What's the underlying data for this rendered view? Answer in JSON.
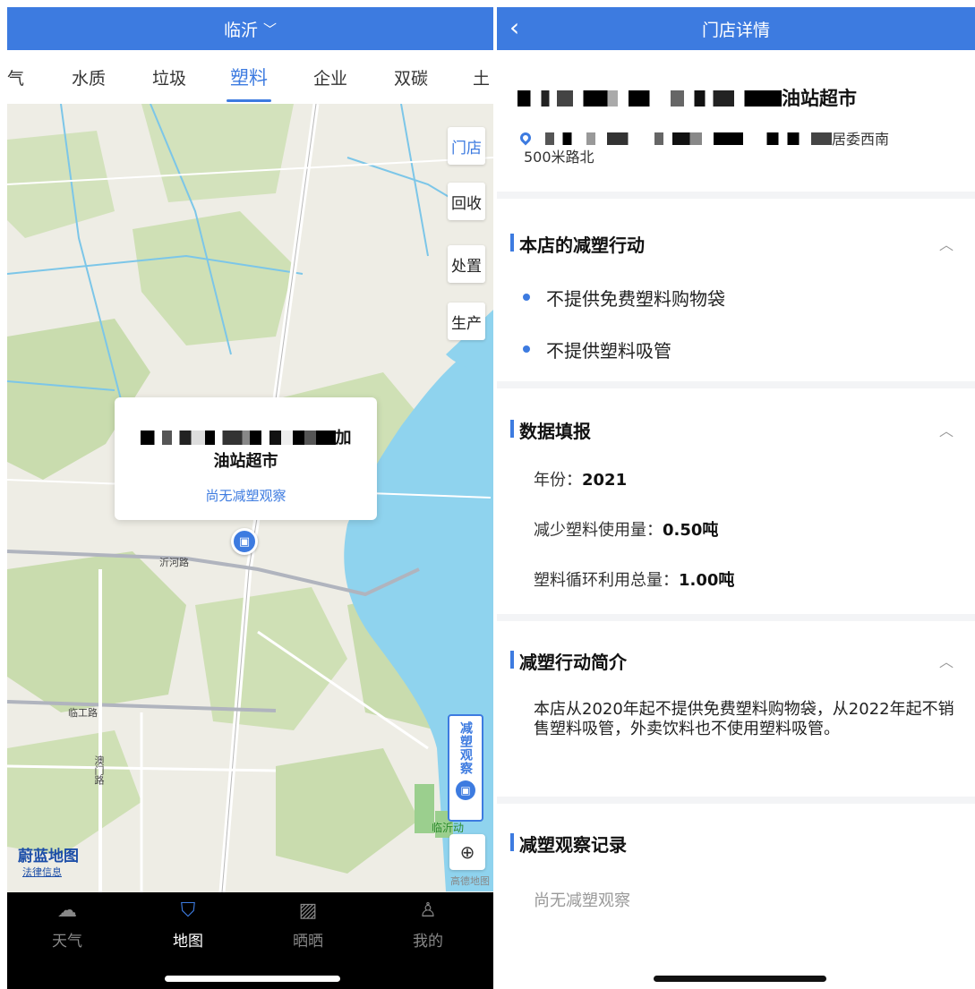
{
  "left": {
    "city": "临沂",
    "tabs": [
      "气",
      "水质",
      "垃圾",
      "塑料",
      "企业",
      "双碳",
      "土"
    ],
    "active_tab": "塑料",
    "side_buttons": [
      "门店",
      "回收",
      "处置",
      "生产"
    ],
    "popup": {
      "name_suffix_1": "加",
      "name_line_2": "油站超市",
      "observation": "尚无减塑观察"
    },
    "road_labels": [
      "沂河路",
      "临工路",
      "澳门路"
    ],
    "jsgc_label": "减塑观察",
    "map_logo": "蔚蓝地图",
    "legal": "法律信息",
    "zoo_label": "临沂动",
    "gaode": "高德地图",
    "nav": [
      {
        "label": "天气",
        "icon": "cloud-icon"
      },
      {
        "label": "地图",
        "icon": "map-pin-icon"
      },
      {
        "label": "晒晒",
        "icon": "photo-icon"
      },
      {
        "label": "我的",
        "icon": "user-icon"
      }
    ],
    "colors": {
      "primary": "#3d7be0"
    }
  },
  "right": {
    "title": "门店详情",
    "store_name_suffix": "油站超市",
    "address_suffix": "居委西南",
    "address_line_2": "500米路北",
    "sections": {
      "actions": {
        "title": "本店的减塑行动",
        "items": [
          "不提供免费塑料购物袋",
          "不提供塑料吸管"
        ]
      },
      "data": {
        "title": "数据填报",
        "year_label": "年份：",
        "year": "2021",
        "reduce_label": "减少塑料使用量：",
        "reduce_value": "0.50吨",
        "recycle_label": "塑料循环利用总量：",
        "recycle_value": "1.00吨"
      },
      "intro": {
        "title": "减塑行动简介",
        "text": "本店从2020年起不提供免费塑料购物袋，从2022年起不销售塑料吸管，外卖饮料也不使用塑料吸管。"
      },
      "records": {
        "title": "减塑观察记录",
        "empty": "尚无减塑观察"
      }
    }
  }
}
